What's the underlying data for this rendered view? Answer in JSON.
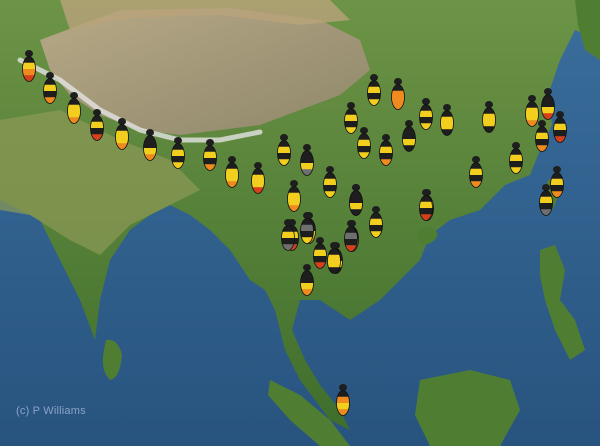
{
  "credit": "(c) P Williams",
  "colors": {
    "black": "#1e1e1e",
    "grey": "#6f6f6f",
    "yellow": "#f2cf1e",
    "orange": "#ef8a1e",
    "red": "#d4411a",
    "ocean": "#2f5f8f",
    "land": "#5f8a3e",
    "plateau": "#a89b78",
    "snow": "#e6e6e6"
  },
  "bumblebee_markers": [
    {
      "bands": [
        "black",
        "yellow",
        "orange",
        "red"
      ]
    },
    {
      "bands": [
        "black",
        "yellow",
        "black",
        "orange"
      ]
    },
    {
      "bands": [
        "black",
        "yellow",
        "yellow",
        "orange"
      ]
    },
    {
      "bands": [
        "black",
        "yellow",
        "black",
        "red"
      ]
    },
    {
      "bands": [
        "black",
        "yellow",
        "yellow",
        "orange"
      ]
    },
    {
      "bands": [
        "black",
        "black",
        "yellow",
        "orange"
      ]
    },
    {
      "bands": [
        "black",
        "yellow",
        "black",
        "yellow"
      ]
    },
    {
      "bands": [
        "black",
        "yellow",
        "black",
        "orange"
      ]
    },
    {
      "bands": [
        "black",
        "yellow",
        "yellow",
        "orange"
      ]
    },
    {
      "bands": [
        "black",
        "yellow",
        "yellow",
        "red"
      ]
    },
    {
      "bands": [
        "black",
        "yellow",
        "black",
        "yellow"
      ]
    },
    {
      "bands": [
        "black",
        "black",
        "yellow",
        "grey"
      ]
    },
    {
      "bands": [
        "black",
        "yellow",
        "yellow",
        "orange"
      ]
    },
    {
      "bands": [
        "black",
        "yellow",
        "black",
        "red"
      ]
    },
    {
      "bands": [
        "black",
        "black",
        "yellow",
        "orange"
      ]
    },
    {
      "bands": [
        "black",
        "yellow",
        "black",
        "red"
      ]
    },
    {
      "bands": [
        "black",
        "black",
        "yellow",
        "black"
      ]
    },
    {
      "bands": [
        "black",
        "black",
        "yellow",
        "orange"
      ]
    },
    {
      "bands": [
        "black",
        "yellow",
        "black",
        "yellow"
      ]
    },
    {
      "bands": [
        "black",
        "yellow",
        "black",
        "yellow"
      ]
    },
    {
      "bands": [
        "black",
        "black",
        "yellow",
        "orange"
      ]
    },
    {
      "bands": [
        "black",
        "yellow",
        "black",
        "yellow"
      ]
    },
    {
      "bands": [
        "black",
        "yellow",
        "black",
        "yellow"
      ]
    },
    {
      "bands": [
        "black",
        "orange",
        "orange",
        "orange"
      ]
    },
    {
      "bands": [
        "black",
        "yellow",
        "black",
        "yellow"
      ]
    },
    {
      "bands": [
        "black",
        "yellow",
        "black",
        "yellow"
      ]
    },
    {
      "bands": [
        "black",
        "yellow",
        "black",
        "orange"
      ]
    },
    {
      "bands": [
        "black",
        "black",
        "yellow",
        "black"
      ]
    },
    {
      "bands": [
        "black",
        "yellow",
        "black",
        "yellow"
      ]
    },
    {
      "bands": [
        "black",
        "yellow",
        "yellow",
        "black"
      ]
    },
    {
      "bands": [
        "black",
        "yellow",
        "yellow",
        "black"
      ]
    },
    {
      "bands": [
        "black",
        "yellow",
        "yellow",
        "orange"
      ]
    },
    {
      "bands": [
        "black",
        "black",
        "yellow",
        "red"
      ]
    },
    {
      "bands": [
        "black",
        "yellow",
        "black",
        "red"
      ]
    },
    {
      "bands": [
        "black",
        "yellow",
        "black",
        "orange"
      ]
    },
    {
      "bands": [
        "black",
        "yellow",
        "black",
        "yellow"
      ]
    },
    {
      "bands": [
        "black",
        "yellow",
        "black",
        "orange"
      ]
    },
    {
      "bands": [
        "black",
        "yellow",
        "black",
        "yellow"
      ]
    },
    {
      "bands": [
        "black",
        "yellow",
        "black",
        "grey"
      ]
    },
    {
      "bands": [
        "black",
        "yellow",
        "black",
        "orange"
      ]
    },
    {
      "bands": [
        "black",
        "yellow",
        "black",
        "grey"
      ]
    },
    {
      "bands": [
        "black",
        "grey",
        "black",
        "yellow"
      ]
    },
    {
      "bands": [
        "black",
        "yellow",
        "yellow",
        "black"
      ]
    },
    {
      "bands": [
        "black",
        "grey",
        "black",
        "red"
      ]
    },
    {
      "bands": [
        "black",
        "black",
        "yellow",
        "black"
      ]
    },
    {
      "bands": [
        "black",
        "yellow",
        "black",
        "red"
      ]
    },
    {
      "bands": [
        "black",
        "orange",
        "yellow",
        "orange"
      ]
    }
  ]
}
